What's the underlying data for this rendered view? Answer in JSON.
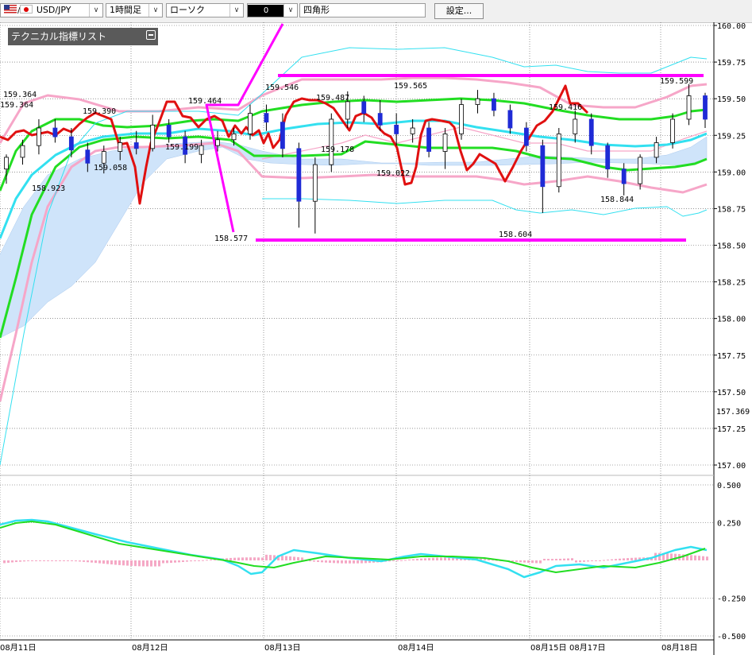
{
  "toolbar": {
    "symbol": "USD/JPY",
    "timeframe": "1時間足",
    "chart_style": "ローソク",
    "line_style": "0",
    "shape": "四角形",
    "settings_label": "設定..."
  },
  "panel": {
    "title": "テクニカル指標リスト"
  },
  "colors": {
    "candle_up": "#ffffff",
    "candle_down": "#1f2bd6",
    "red_line": "#e01010",
    "green_band": "#22dd22",
    "cyan_line": "#33e0f0",
    "pink_band": "#f6a6c8",
    "cloud": "#cfe4fa",
    "magenta": "#ff00ff"
  },
  "chart_data": [
    {
      "type": "candlestick",
      "title": "",
      "price_axis_ticks": [
        "160.00",
        "159.75",
        "159.50",
        "159.25",
        "159.00",
        "158.75",
        "158.50",
        "158.25",
        "158.00",
        "157.75",
        "157.50",
        "157.25",
        "157.00"
      ],
      "current_price_label": "157.369",
      "ylim": [
        156.8,
        160.0
      ],
      "date_labels": [
        "08月11日",
        "08月12日",
        "08月13日",
        "08月14日",
        "08月15日",
        "08月17日",
        "08月18日"
      ],
      "price_annotations": [
        "159.364",
        "159.364",
        "158.923",
        "159.390",
        "159.058",
        "159.199",
        "159.464",
        "158.577",
        "159.546",
        "159.487",
        "159.178",
        "159.022",
        "159.565",
        "158.604",
        "159.416",
        "158.844",
        "159.599"
      ],
      "candles_approx": [
        {
          "o": 159.02,
          "h": 159.12,
          "l": 158.92,
          "c": 159.1
        },
        {
          "o": 159.1,
          "h": 159.22,
          "l": 159.05,
          "c": 159.18
        },
        {
          "o": 159.18,
          "h": 159.36,
          "l": 159.12,
          "c": 159.3
        },
        {
          "o": 159.3,
          "h": 159.36,
          "l": 159.2,
          "c": 159.24
        },
        {
          "o": 159.24,
          "h": 159.3,
          "l": 159.1,
          "c": 159.15
        },
        {
          "o": 159.15,
          "h": 159.2,
          "l": 159.0,
          "c": 159.06
        },
        {
          "o": 159.06,
          "h": 159.18,
          "l": 158.99,
          "c": 159.14
        },
        {
          "o": 159.14,
          "h": 159.24,
          "l": 159.08,
          "c": 159.2
        },
        {
          "o": 159.2,
          "h": 159.28,
          "l": 159.12,
          "c": 159.16
        },
        {
          "o": 159.16,
          "h": 159.39,
          "l": 159.14,
          "c": 159.32
        },
        {
          "o": 159.32,
          "h": 159.36,
          "l": 159.2,
          "c": 159.24
        },
        {
          "o": 159.24,
          "h": 159.28,
          "l": 159.06,
          "c": 159.12
        },
        {
          "o": 159.12,
          "h": 159.22,
          "l": 159.06,
          "c": 159.18
        },
        {
          "o": 159.18,
          "h": 159.28,
          "l": 159.14,
          "c": 159.22
        },
        {
          "o": 159.22,
          "h": 159.3,
          "l": 159.18,
          "c": 159.26
        },
        {
          "o": 159.26,
          "h": 159.46,
          "l": 159.22,
          "c": 159.4
        },
        {
          "o": 159.4,
          "h": 159.46,
          "l": 159.28,
          "c": 159.34
        },
        {
          "o": 159.34,
          "h": 159.4,
          "l": 159.1,
          "c": 159.16
        },
        {
          "o": 159.16,
          "h": 159.2,
          "l": 158.62,
          "c": 158.8
        },
        {
          "o": 158.8,
          "h": 159.1,
          "l": 158.58,
          "c": 159.05
        },
        {
          "o": 159.05,
          "h": 159.4,
          "l": 159.0,
          "c": 159.36
        },
        {
          "o": 159.36,
          "h": 159.55,
          "l": 159.3,
          "c": 159.48
        },
        {
          "o": 159.48,
          "h": 159.52,
          "l": 159.34,
          "c": 159.4
        },
        {
          "o": 159.4,
          "h": 159.49,
          "l": 159.28,
          "c": 159.32
        },
        {
          "o": 159.32,
          "h": 159.4,
          "l": 159.18,
          "c": 159.26
        },
        {
          "o": 159.26,
          "h": 159.36,
          "l": 159.2,
          "c": 159.3
        },
        {
          "o": 159.3,
          "h": 159.34,
          "l": 159.1,
          "c": 159.14
        },
        {
          "o": 159.14,
          "h": 159.3,
          "l": 159.02,
          "c": 159.26
        },
        {
          "o": 159.26,
          "h": 159.5,
          "l": 159.22,
          "c": 159.46
        },
        {
          "o": 159.46,
          "h": 159.56,
          "l": 159.4,
          "c": 159.5
        },
        {
          "o": 159.5,
          "h": 159.54,
          "l": 159.38,
          "c": 159.42
        },
        {
          "o": 159.42,
          "h": 159.46,
          "l": 159.26,
          "c": 159.3
        },
        {
          "o": 159.3,
          "h": 159.34,
          "l": 159.14,
          "c": 159.18
        },
        {
          "o": 159.18,
          "h": 159.22,
          "l": 158.72,
          "c": 158.9
        },
        {
          "o": 158.9,
          "h": 159.3,
          "l": 158.86,
          "c": 159.26
        },
        {
          "o": 159.26,
          "h": 159.42,
          "l": 159.2,
          "c": 159.36
        },
        {
          "o": 159.36,
          "h": 159.4,
          "l": 159.12,
          "c": 159.18
        },
        {
          "o": 159.18,
          "h": 159.2,
          "l": 158.96,
          "c": 159.02
        },
        {
          "o": 159.02,
          "h": 159.06,
          "l": 158.84,
          "c": 158.92
        },
        {
          "o": 158.92,
          "h": 159.12,
          "l": 158.88,
          "c": 159.1
        },
        {
          "o": 159.1,
          "h": 159.24,
          "l": 159.06,
          "c": 159.2
        },
        {
          "o": 159.2,
          "h": 159.4,
          "l": 159.16,
          "c": 159.36
        },
        {
          "o": 159.36,
          "h": 159.6,
          "l": 159.32,
          "c": 159.52
        },
        {
          "o": 159.52,
          "h": 159.54,
          "l": 159.3,
          "c": 159.36
        }
      ]
    },
    {
      "type": "line",
      "title": "",
      "oscillator_ticks": [
        "0.500",
        "0.250",
        "-0.250",
        "-0.500"
      ],
      "ylim": [
        -0.5,
        0.5
      ]
    }
  ]
}
